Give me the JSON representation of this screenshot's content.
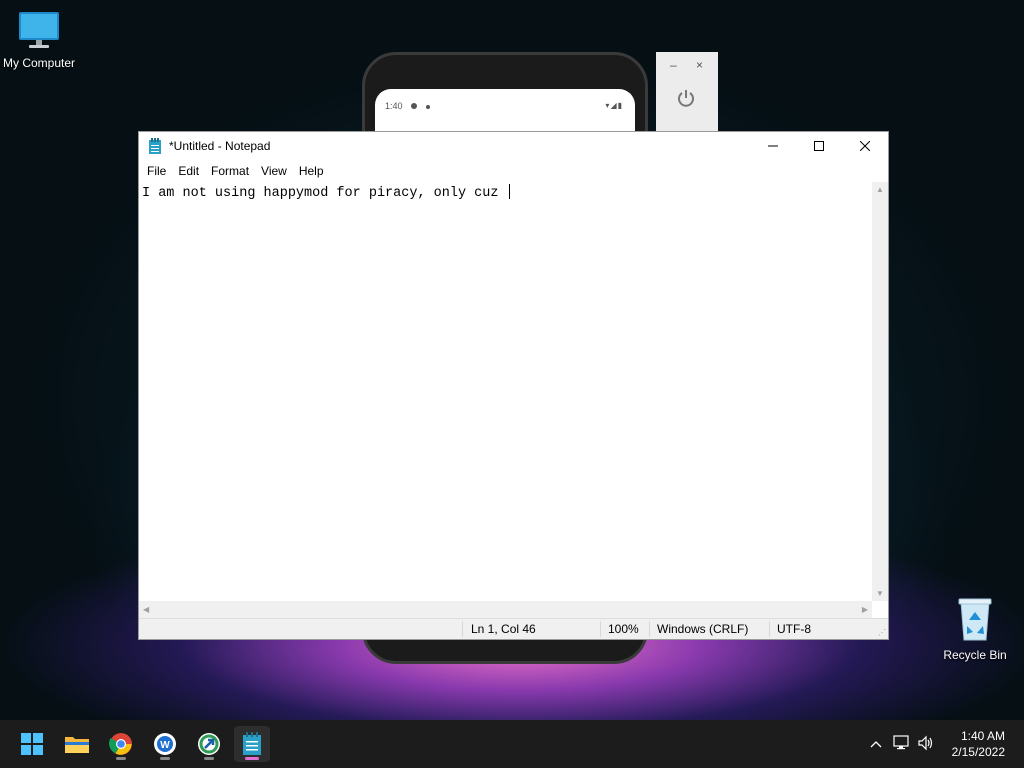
{
  "desktop": {
    "icons": [
      {
        "label": "My Computer",
        "icon": "monitor-icon"
      },
      {
        "label": "Recycle Bin",
        "icon": "recycle-bin-icon"
      }
    ]
  },
  "phone": {
    "status_time": "1:40"
  },
  "emulator_panel": {
    "minimize": "–",
    "close": "×"
  },
  "notepad": {
    "title": "*Untitled - Notepad",
    "menu": [
      "File",
      "Edit",
      "Format",
      "View",
      "Help"
    ],
    "content": "I am not using happymod for piracy, only cuz ",
    "status": {
      "position": "Ln 1, Col 46",
      "zoom": "100%",
      "line_ending": "Windows (CRLF)",
      "encoding": "UTF-8"
    }
  },
  "taskbar": {
    "apps": [
      {
        "name": "start-button",
        "icon": "windows-logo-icon"
      },
      {
        "name": "file-explorer",
        "icon": "folder-icon"
      },
      {
        "name": "chrome",
        "icon": "chrome-icon"
      },
      {
        "name": "app-w",
        "icon": "blue-w-app-icon"
      },
      {
        "name": "app-green",
        "icon": "green-arrow-app-icon"
      },
      {
        "name": "notepad",
        "icon": "notepad-icon",
        "active": true
      }
    ],
    "clock": {
      "time": "1:40 AM",
      "date": "2/15/2022"
    }
  },
  "colors": {
    "accent_indicator": "#e06fd6",
    "notepad_icon": "#2aa0c8"
  }
}
